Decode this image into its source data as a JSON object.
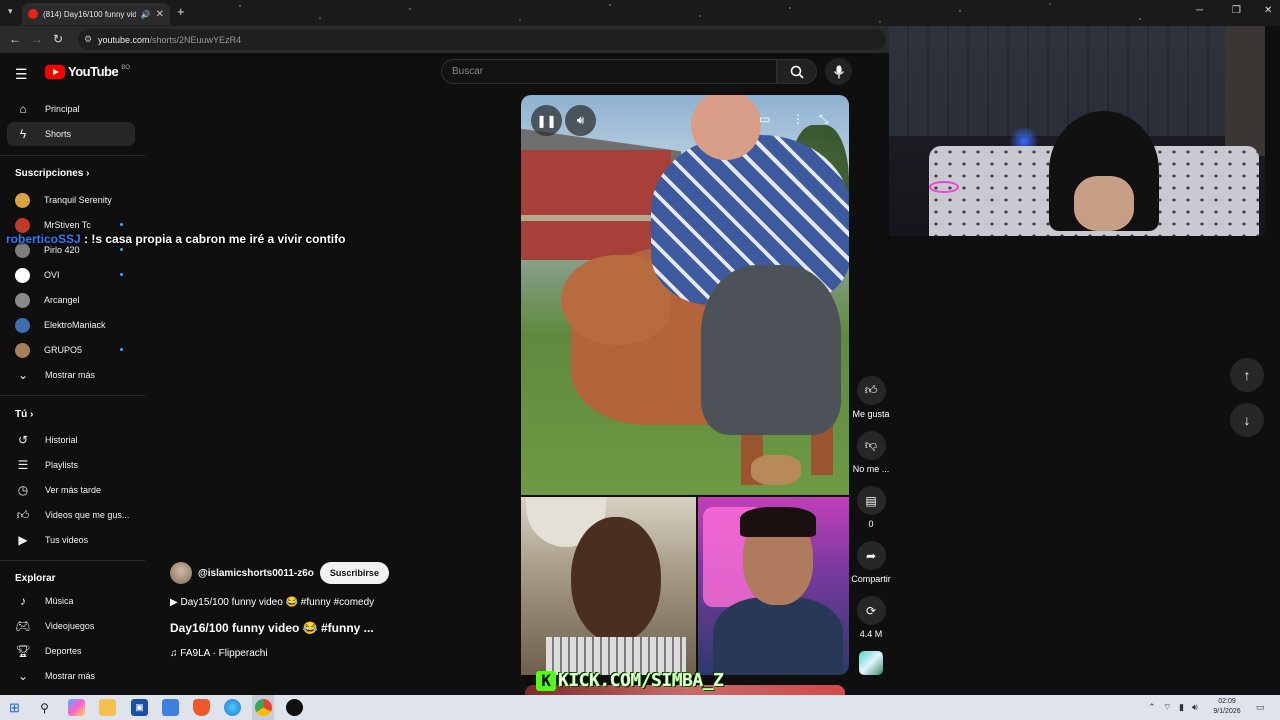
{
  "browser": {
    "tab_title": "(814) Day16/100 funny vide",
    "url_host": "youtube.com",
    "url_path": "/shorts/2NEuuwYEzR4"
  },
  "youtube": {
    "logo_text": "YouTube",
    "country_code": "BO",
    "search_placeholder": "Buscar"
  },
  "sidebar": {
    "main": [
      {
        "label": "Principal",
        "icon": "home-icon"
      },
      {
        "label": "Shorts",
        "icon": "shorts-icon"
      }
    ],
    "subscriptions_heading": "Suscripciones",
    "subscriptions": [
      {
        "label": "Tranquil Serenity",
        "color": "#d9a441"
      },
      {
        "label": "MrStiven Tc",
        "color": "#c0392b"
      },
      {
        "label": "Pirlo 420",
        "color": "#7d7d7d"
      },
      {
        "label": "OVI",
        "color": "#ffffff"
      },
      {
        "label": "Arcangel",
        "color": "#8a8a8a"
      },
      {
        "label": "ElektroManiack",
        "color": "#3d6fb0"
      },
      {
        "label": "GRUPO5",
        "color": "#a87d5a"
      }
    ],
    "show_more": "Mostrar más",
    "you_heading": "Tú",
    "you": [
      {
        "label": "Historial",
        "icon": "history-icon"
      },
      {
        "label": "Playlists",
        "icon": "playlists-icon"
      },
      {
        "label": "Ver más tarde",
        "icon": "watch-later-icon"
      },
      {
        "label": "Videos que me gus...",
        "icon": "liked-videos-icon"
      },
      {
        "label": "Tus videos",
        "icon": "your-videos-icon"
      }
    ],
    "explore_heading": "Explorar",
    "explore": [
      {
        "label": "Música",
        "icon": "music-icon"
      },
      {
        "label": "Videojuegos",
        "icon": "gaming-icon"
      },
      {
        "label": "Deportes",
        "icon": "sports-icon"
      },
      {
        "label": "Mostrar más",
        "icon": "chevron-down-icon"
      }
    ]
  },
  "chat": {
    "user": "roberticoSSJ",
    "message": ": !s casa propia a cabron me iré a vivir contifo"
  },
  "short": {
    "channel": "@islamicshorts0011-z6o",
    "subscribe": "Suscribirse",
    "playlist_line": "▶ Day15/100 funny video 😂 #funny #comedy",
    "title": "Day16/100 funny video 😂 #funny ...",
    "music": "♫ FA9LA · Flipperachi"
  },
  "actions": {
    "like": "Me gusta",
    "dislike": "No me ...",
    "comments": "0",
    "share": "Compartir",
    "remix": "4.4 M"
  },
  "watermark": "KICK.COM/SIMBA_Z",
  "clock": {
    "time": "02:09",
    "date": "9/1/2026"
  }
}
